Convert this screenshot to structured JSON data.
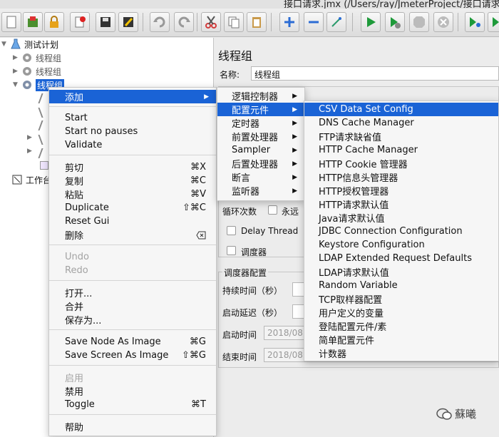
{
  "window": {
    "title": "接口请求.jmx (/Users/ray/JmeterProject/接口请求.jmx"
  },
  "tree": {
    "root": "测试计划",
    "thread_groups": [
      "线程组",
      "线程组",
      "线程组"
    ],
    "workbench": "工作台"
  },
  "panel": {
    "title": "线程组",
    "name_label": "名称:",
    "name_value": "线程组",
    "loop_label": "循环次数",
    "forever_label": "永远",
    "delay_label": "Delay Thread",
    "scheduler_label": "调度器",
    "scheduler_config_label": "调度器配置",
    "duration_label": "持续时间（秒）",
    "startup_delay_label": "启动延迟（秒）",
    "start_time_label": "启动时间",
    "start_time_value": "2018/08",
    "end_time_label": "结束时间",
    "end_time_value": "2018/08"
  },
  "context_menu": {
    "add": "添加",
    "start": "Start",
    "start_no_pauses": "Start no pauses",
    "validate": "Validate",
    "cut": "剪切",
    "cut_sc": "⌘X",
    "copy": "复制",
    "copy_sc": "⌘C",
    "paste": "粘贴",
    "paste_sc": "⌘V",
    "duplicate": "Duplicate",
    "duplicate_sc": "⇧⌘C",
    "reset_gui": "Reset Gui",
    "delete": "删除",
    "undo": "Undo",
    "redo": "Redo",
    "open": "打开...",
    "merge": "合并",
    "save_as": "保存为...",
    "save_node_image": "Save Node As Image",
    "save_node_image_sc": "⌘G",
    "save_screen_image": "Save Screen As Image",
    "save_screen_image_sc": "⇧⌘G",
    "enable": "启用",
    "disable": "禁用",
    "toggle": "Toggle",
    "toggle_sc": "⌘T",
    "help": "帮助"
  },
  "add_submenu": [
    "逻辑控制器",
    "配置元件",
    "定时器",
    "前置处理器",
    "Sampler",
    "后置处理器",
    "断言",
    "监听器"
  ],
  "config_submenu": [
    "CSV Data Set Config",
    "DNS Cache Manager",
    "FTP请求缺省值",
    "HTTP Cache Manager",
    "HTTP Cookie 管理器",
    "HTTP信息头管理器",
    "HTTP授权管理器",
    "HTTP请求默认值",
    "Java请求默认值",
    "JDBC Connection Configuration",
    "Keystore Configuration",
    "LDAP Extended Request Defaults",
    "LDAP请求默认值",
    "Random Variable",
    "TCP取样器配置",
    "用户定义的变量",
    "登陆配置元件/素",
    "简单配置元件",
    "计数器"
  ],
  "watermark": "蘇曦",
  "colors": {
    "highlight": "#1a63d6",
    "run": "#1e9a3a",
    "add": "#2b6cd4",
    "cut": "#d23c3c"
  }
}
